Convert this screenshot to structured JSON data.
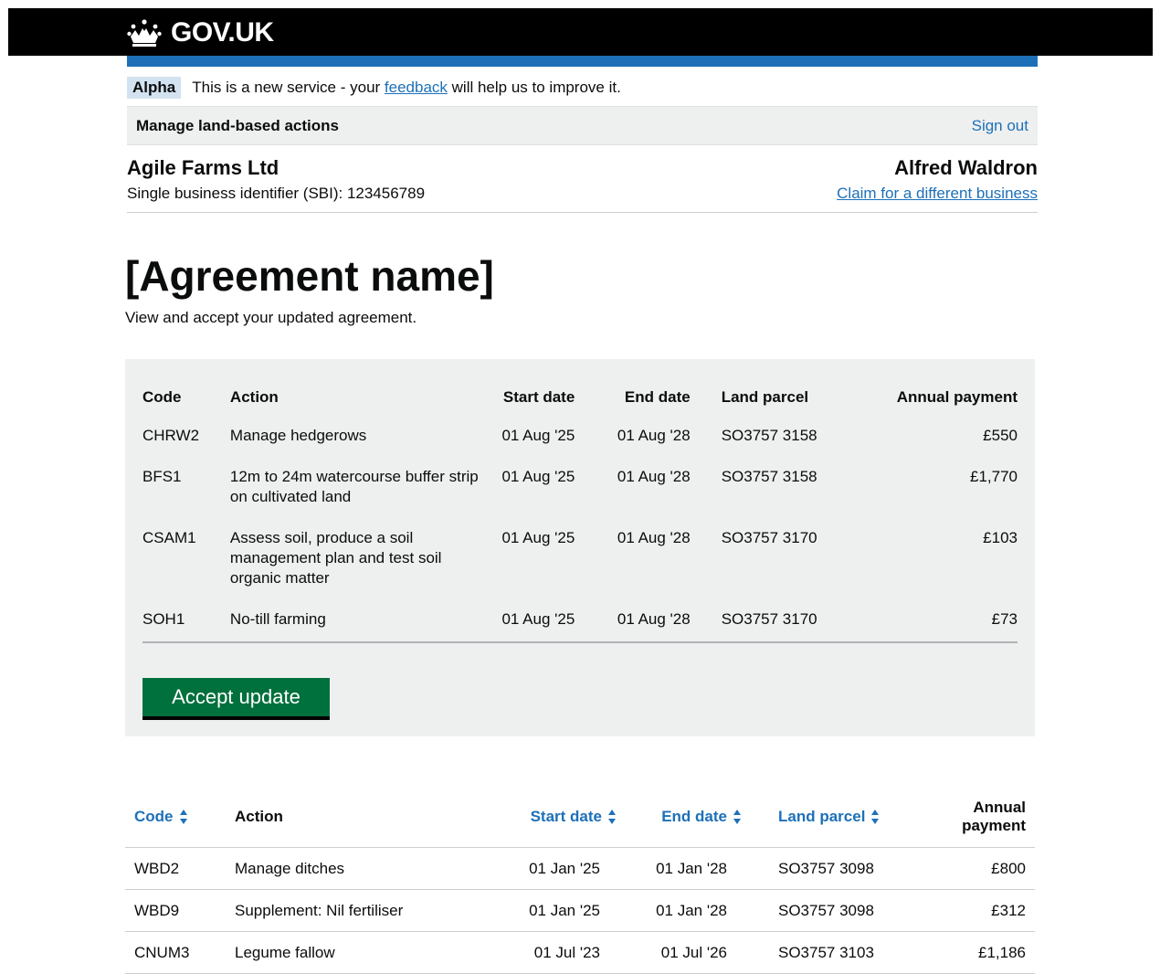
{
  "header": {
    "logo_text": "GOV.UK"
  },
  "phase": {
    "tag": "Alpha",
    "text_before": "This is a new service - your ",
    "link": "feedback",
    "text_after": " will help us to improve it."
  },
  "service": {
    "name": "Manage land-based actions",
    "sign_out": "Sign out"
  },
  "business": {
    "name": "Agile Farms Ltd",
    "sbi": "Single business identifier (SBI): 123456789",
    "user": "Alfred Waldron",
    "claim_link": "Claim for a different business"
  },
  "page": {
    "title": "[Agreement name]",
    "lede": "View and accept your updated agreement."
  },
  "update_table": {
    "headers": {
      "code": "Code",
      "action": "Action",
      "start": "Start date",
      "end": "End date",
      "parcel": "Land parcel",
      "payment": "Annual payment"
    },
    "rows": [
      {
        "code": "CHRW2",
        "action": "Manage hedgerows",
        "start": "01 Aug '25",
        "end": "01 Aug '28",
        "parcel": "SO3757 3158",
        "payment": "£550"
      },
      {
        "code": "BFS1",
        "action": "12m to 24m watercourse buffer strip on cultivated land",
        "start": "01 Aug '25",
        "end": "01 Aug '28",
        "parcel": "SO3757 3158",
        "payment": "£1,770"
      },
      {
        "code": "CSAM1",
        "action": "Assess soil, produce a soil management plan and test soil organic matter",
        "start": "01 Aug '25",
        "end": "01 Aug '28",
        "parcel": "SO3757 3170",
        "payment": "£103"
      },
      {
        "code": "SOH1",
        "action": "No-till farming",
        "start": "01 Aug '25",
        "end": "01 Aug '28",
        "parcel": "SO3757 3170",
        "payment": "£73"
      }
    ],
    "accept_button": "Accept update"
  },
  "current_table": {
    "headers": {
      "code": "Code",
      "action": "Action",
      "start": "Start date",
      "end": "End date",
      "parcel": "Land parcel",
      "payment": "Annual payment"
    },
    "rows": [
      {
        "code": "WBD2",
        "action": "Manage ditches",
        "start": "01 Jan '25",
        "end": "01 Jan '28",
        "parcel": "SO3757 3098",
        "payment": "£800"
      },
      {
        "code": "WBD9",
        "action": "Supplement: Nil fertiliser",
        "start": "01 Jan '25",
        "end": "01 Jan '28",
        "parcel": "SO3757 3098",
        "payment": "£312"
      },
      {
        "code": "CNUM3",
        "action": "Legume fallow",
        "start": "01 Jul '23",
        "end": "01 Jul '26",
        "parcel": "SO3757 3103",
        "payment": "£1,186"
      }
    ]
  },
  "colors": {
    "brand_blue": "#1d70b8",
    "button_green": "#00703c",
    "panel_grey": "#eef0f0"
  }
}
